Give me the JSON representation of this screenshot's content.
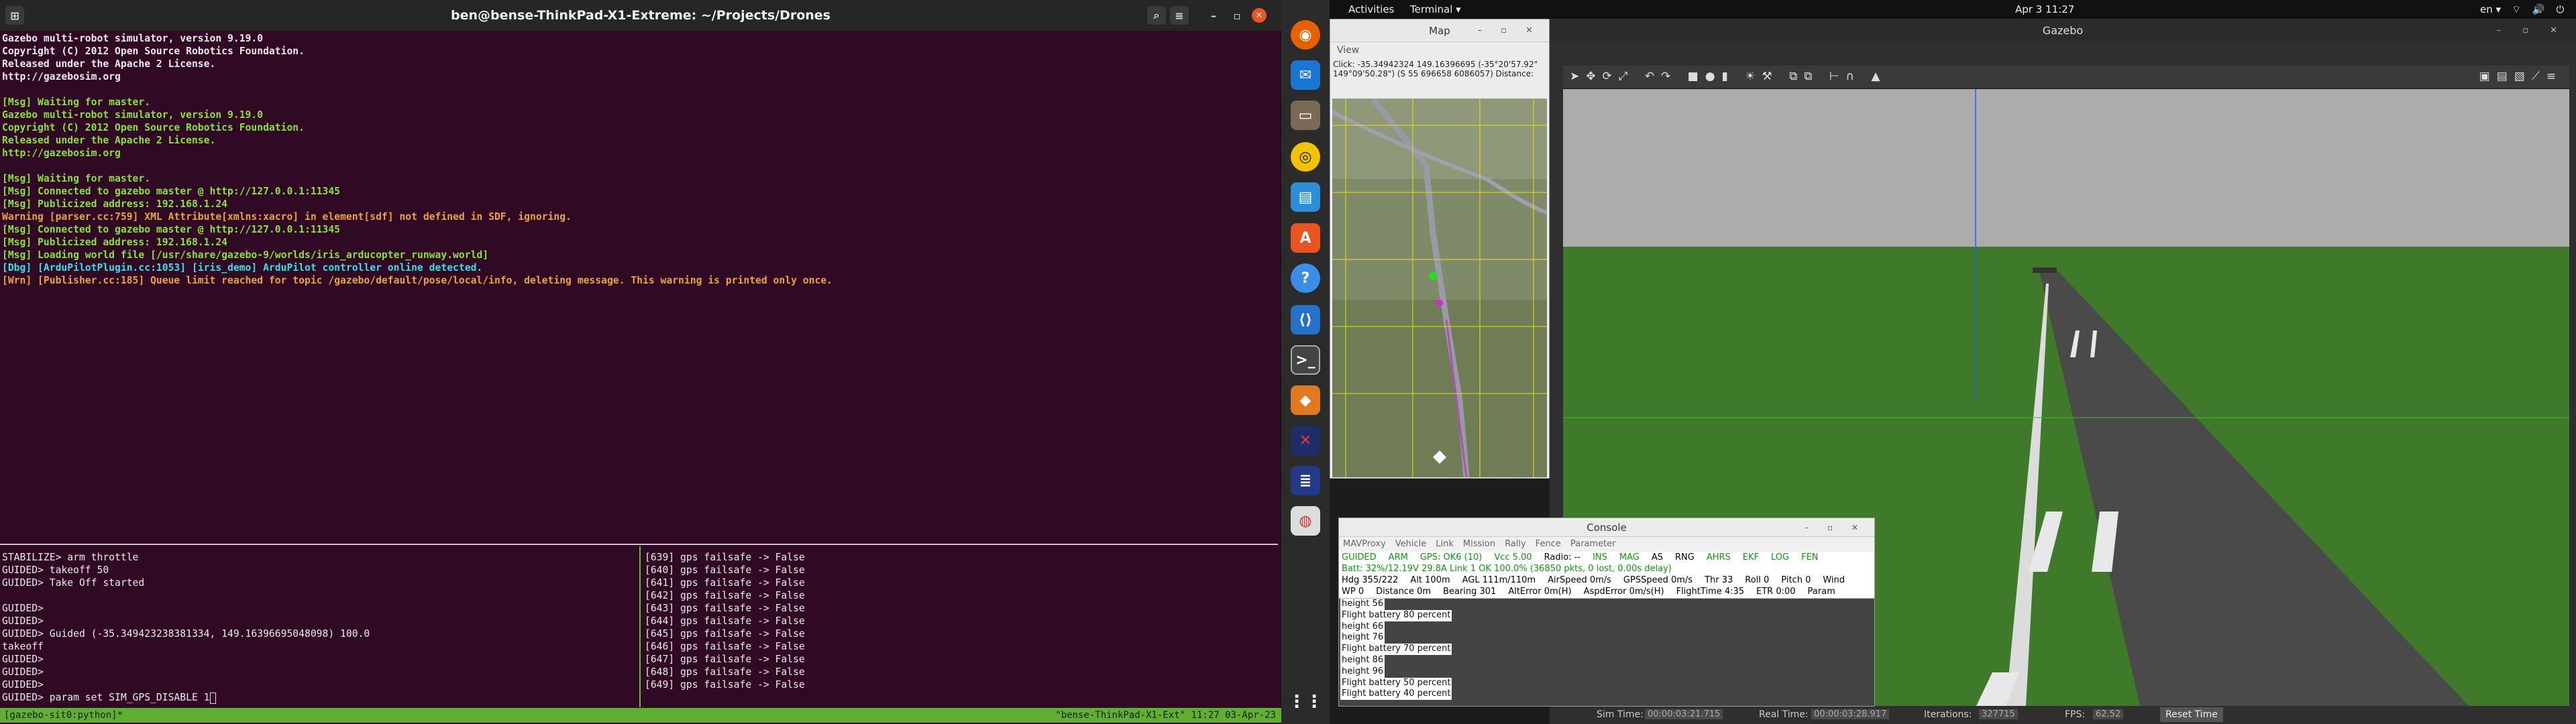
{
  "terminal": {
    "title": "ben@bense-ThinkPad-X1-Extreme: ~/Projects/Drones",
    "lines": [
      {
        "text": "Gazebo multi-robot simulator, version 9.19.0",
        "cls": "white"
      },
      {
        "text": "Copyright (C) 2012 Open Source Robotics Foundation.",
        "cls": "white"
      },
      {
        "text": "Released under the Apache 2 License.",
        "cls": "white"
      },
      {
        "text": "http://gazebosim.org",
        "cls": "white"
      },
      {
        "text": "",
        "cls": "white"
      },
      {
        "text": "[Msg] Waiting for master.",
        "cls": "green"
      },
      {
        "text": "Gazebo multi-robot simulator, version 9.19.0",
        "cls": "green"
      },
      {
        "text": "Copyright (C) 2012 Open Source Robotics Foundation.",
        "cls": "green"
      },
      {
        "text": "Released under the Apache 2 License.",
        "cls": "green"
      },
      {
        "text": "http://gazebosim.org",
        "cls": "green"
      },
      {
        "text": "",
        "cls": "white"
      },
      {
        "text": "[Msg] Waiting for master.",
        "cls": "green"
      },
      {
        "text": "[Msg] Connected to gazebo master @ http://127.0.0.1:11345",
        "cls": "green"
      },
      {
        "text": "[Msg] Publicized address: 192.168.1.24",
        "cls": "green"
      },
      {
        "text": "Warning [parser.cc:759] XML Attribute[xmlns:xacro] in element[sdf] not defined in SDF, ignoring.",
        "cls": "orange"
      },
      {
        "text": "[Msg] Connected to gazebo master @ http://127.0.0.1:11345",
        "cls": "green"
      },
      {
        "text": "[Msg] Publicized address: 192.168.1.24",
        "cls": "green"
      },
      {
        "text": "[Msg] Loading world file [/usr/share/gazebo-9/worlds/iris_arducopter_runway.world]",
        "cls": "green"
      },
      {
        "text": "[Dbg] [ArduPilotPlugin.cc:1053] [iris_demo] ArduPilot controller online detected.",
        "cls": "cyan"
      },
      {
        "text": "[Wrn] [Publisher.cc:185] Queue limit reached for topic /gazebo/default/pose/local/info, deleting message. This warning is printed only once.",
        "cls": "orange"
      }
    ],
    "left_pane": [
      "STABILIZE> arm throttle",
      "GUIDED> takeoff 50",
      "GUIDED> Take Off started",
      "",
      "GUIDED>",
      "GUIDED>",
      "GUIDED> Guided (-35.349423238381334, 149.16396695048098) 100.0",
      "takeoff",
      "GUIDED>",
      "GUIDED>",
      "GUIDED>"
    ],
    "prompt": "GUIDED> param set SIM_GPS_DISABLE 1",
    "right_pane": [
      "[639] gps failsafe -> False",
      "[640] gps failsafe -> False",
      "[641] gps failsafe -> False",
      "[642] gps failsafe -> False",
      "[643] gps failsafe -> False",
      "[644] gps failsafe -> False",
      "[645] gps failsafe -> False",
      "[646] gps failsafe -> False",
      "[647] gps failsafe -> False",
      "[648] gps failsafe -> False",
      "[649] gps failsafe -> False"
    ],
    "status_left": "[gazebo-sit0:python]*",
    "status_right": "\"bense-ThinkPad-X1-Ext\" 11:27 03-Apr-23"
  },
  "topbar": {
    "activities": "Activities",
    "app": "Terminal ▾",
    "clock": "Apr 3  11:27",
    "lang": "en ▾"
  },
  "map": {
    "title": "Map",
    "menu": "View",
    "coords": "Click: -35.34942324 149.16396695 (-35°20'57.92\" 149°09'50.28\") (S 55 696658 6086057)  Distance:"
  },
  "gazebo": {
    "title": "Gazebo",
    "sim_time_label": "Sim Time:",
    "sim_time": "00:00:03:21.715",
    "real_time_label": "Real Time:",
    "real_time": "00:00:03:28.917",
    "iterations_label": "Iterations:",
    "iterations": "327715",
    "fps_label": "FPS:",
    "fps": "62.52",
    "reset": "Reset Time"
  },
  "console": {
    "title": "Console",
    "menu": [
      "MAVProxy",
      "Vehicle",
      "Link",
      "Mission",
      "Rally",
      "Fence",
      "Parameter"
    ],
    "row1": [
      "GUIDED",
      "ARM",
      "GPS: OK6 (10)",
      "Vcc 5.00",
      "Radio: --",
      "INS",
      "MAG",
      "AS",
      "RNG",
      "AHRS",
      "EKF",
      "LOG",
      "FEN"
    ],
    "row2": "Batt: 32%/12.19V 29.8A    Link 1 OK 100.0% (36850 pkts, 0 lost, 0.00s delay)",
    "row3": [
      "Hdg 355/222",
      "Alt 100m",
      "AGL 111m/110m",
      "AirSpeed 0m/s",
      "GPSSpeed 0m/s",
      "Thr 33",
      "Roll 0",
      "Pitch 0",
      "Wind"
    ],
    "row4": [
      "WP 0",
      "Distance 0m",
      "Bearing 301",
      "AltError 0m(H)",
      "AspdError 0m/s(H)",
      "FlightTime 4:35",
      "ETR 0:00",
      "Param"
    ],
    "log": [
      "height 56",
      "Flight battery 80 percent",
      "height 66",
      "height 76",
      "Flight battery 70 percent",
      "height 86",
      "height 96",
      "Flight battery 50 percent",
      "Flight battery 40 percent"
    ]
  }
}
